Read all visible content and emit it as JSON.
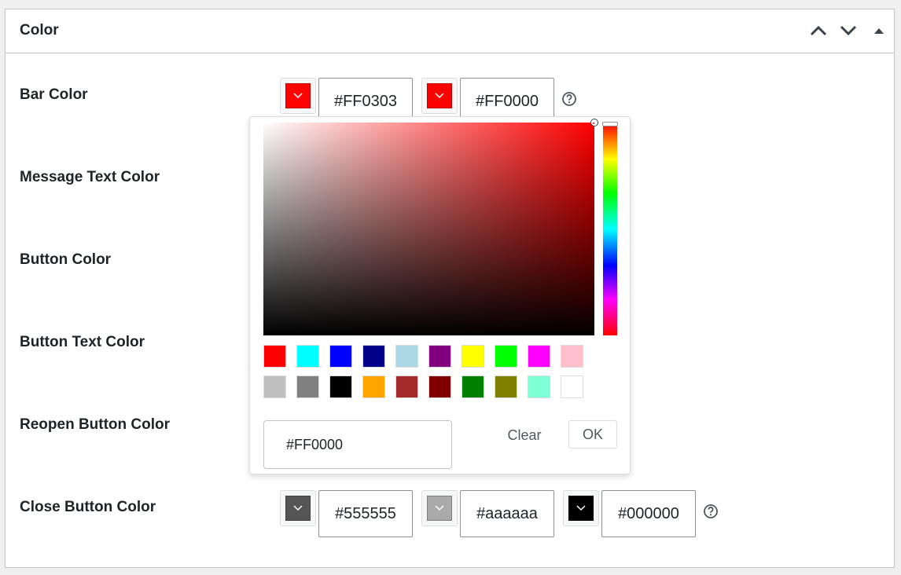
{
  "section": {
    "title": "Color"
  },
  "header_buttons": {
    "move_up_icon": "chevron-up-icon",
    "move_down_icon": "chevron-down-icon",
    "toggle_icon": "caret-up-icon"
  },
  "rows": {
    "bar_color": {
      "label": "Bar Color",
      "value1": "#FF0303",
      "value2": "#FF0000",
      "chip1": "#ff0303",
      "chip2": "#ff0000"
    },
    "message_text_color": {
      "label": "Message Text Color"
    },
    "button_color": {
      "label": "Button Color"
    },
    "button_text_color": {
      "label": "Button Text Color"
    },
    "reopen_button_color": {
      "label": "Reopen Button Color"
    },
    "close_button_color": {
      "label": "Close Button Color",
      "value1": "#555555",
      "value2": "#aaaaaa",
      "value3": "#000000",
      "chip1": "#555555",
      "chip2": "#aaaaaa",
      "chip3": "#000000"
    }
  },
  "picker": {
    "hue_color": "#ff0000",
    "current_value": "#FF0000",
    "clear_label": "Clear",
    "ok_label": "OK",
    "palette": [
      "#ff0000",
      "#00ffff",
      "#0000ff",
      "#00008b",
      "#add8e6",
      "#800080",
      "#ffff00",
      "#00ff00",
      "#ff00ff",
      "#ffc0cb",
      "#c0c0c0",
      "#808080",
      "#000000",
      "#ffa500",
      "#a52a2a",
      "#800000",
      "#008000",
      "#808000",
      "#7fffd4",
      "#ffffff"
    ]
  }
}
